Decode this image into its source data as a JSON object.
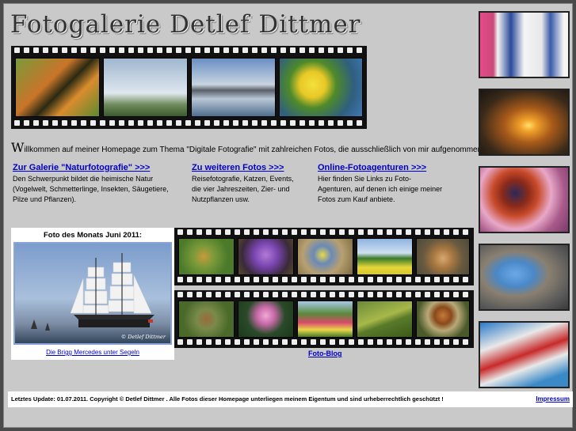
{
  "header": {
    "title": "Fotogalerie Detlef Dittmer"
  },
  "intro": {
    "first_letter": "W",
    "rest": "illkommen auf meiner Homepage zum Thema \"Digitale Fotografie\" mit zahlreichen Fotos, die ausschließlich von mir aufgenommen wurden."
  },
  "columns": [
    {
      "link": "Zur Galerie \"Naturfotografie\" >>>",
      "text": "Den Schwerpunkt bildet die heimische Natur (Vogelwelt, Schmetterlinge, Insekten, Säugetiere, Pilze und Pflanzen)."
    },
    {
      "link": "Zu weiteren Fotos >>>",
      "text": "Reisefotografie, Katzen, Events, die vier Jahreszeiten, Zier- und Nutzpflanzen usw."
    },
    {
      "link": "Online-Fotoagenturen >>>",
      "text": "Hier finden Sie Links zu Foto-Agenturen, auf denen ich einige meiner Fotos zum Kauf anbiete."
    }
  ],
  "photo_of_month": {
    "title": "Foto des Monats Juni 2011:",
    "caption": "Die Brigg Mercedes unter Segeln",
    "watermark": "© Detlef Dittmer"
  },
  "blog": {
    "link": "Foto-Blog"
  },
  "footer": {
    "text": "Letztes Update: 01.07.2011. Copyright © Detlef Dittmer . Alle Fotos dieser Homepage unterliegen meinem Eigentum und sind urheberrechtlich geschützt !",
    "impressum": "Impressum"
  },
  "photos": {
    "header_strip": [
      "butterfly",
      "swans",
      "mountain-lake",
      "lemons"
    ],
    "strip_row1": [
      "hoverfly",
      "crocus",
      "blue-tit",
      "tree-field",
      "cat"
    ],
    "strip_row2": [
      "deer",
      "water-lily",
      "garden",
      "grasshopper",
      "mushroom"
    ],
    "sidebar": [
      "window-door",
      "sunset",
      "peacock-butterfly",
      "rock-arch",
      "boat"
    ]
  }
}
